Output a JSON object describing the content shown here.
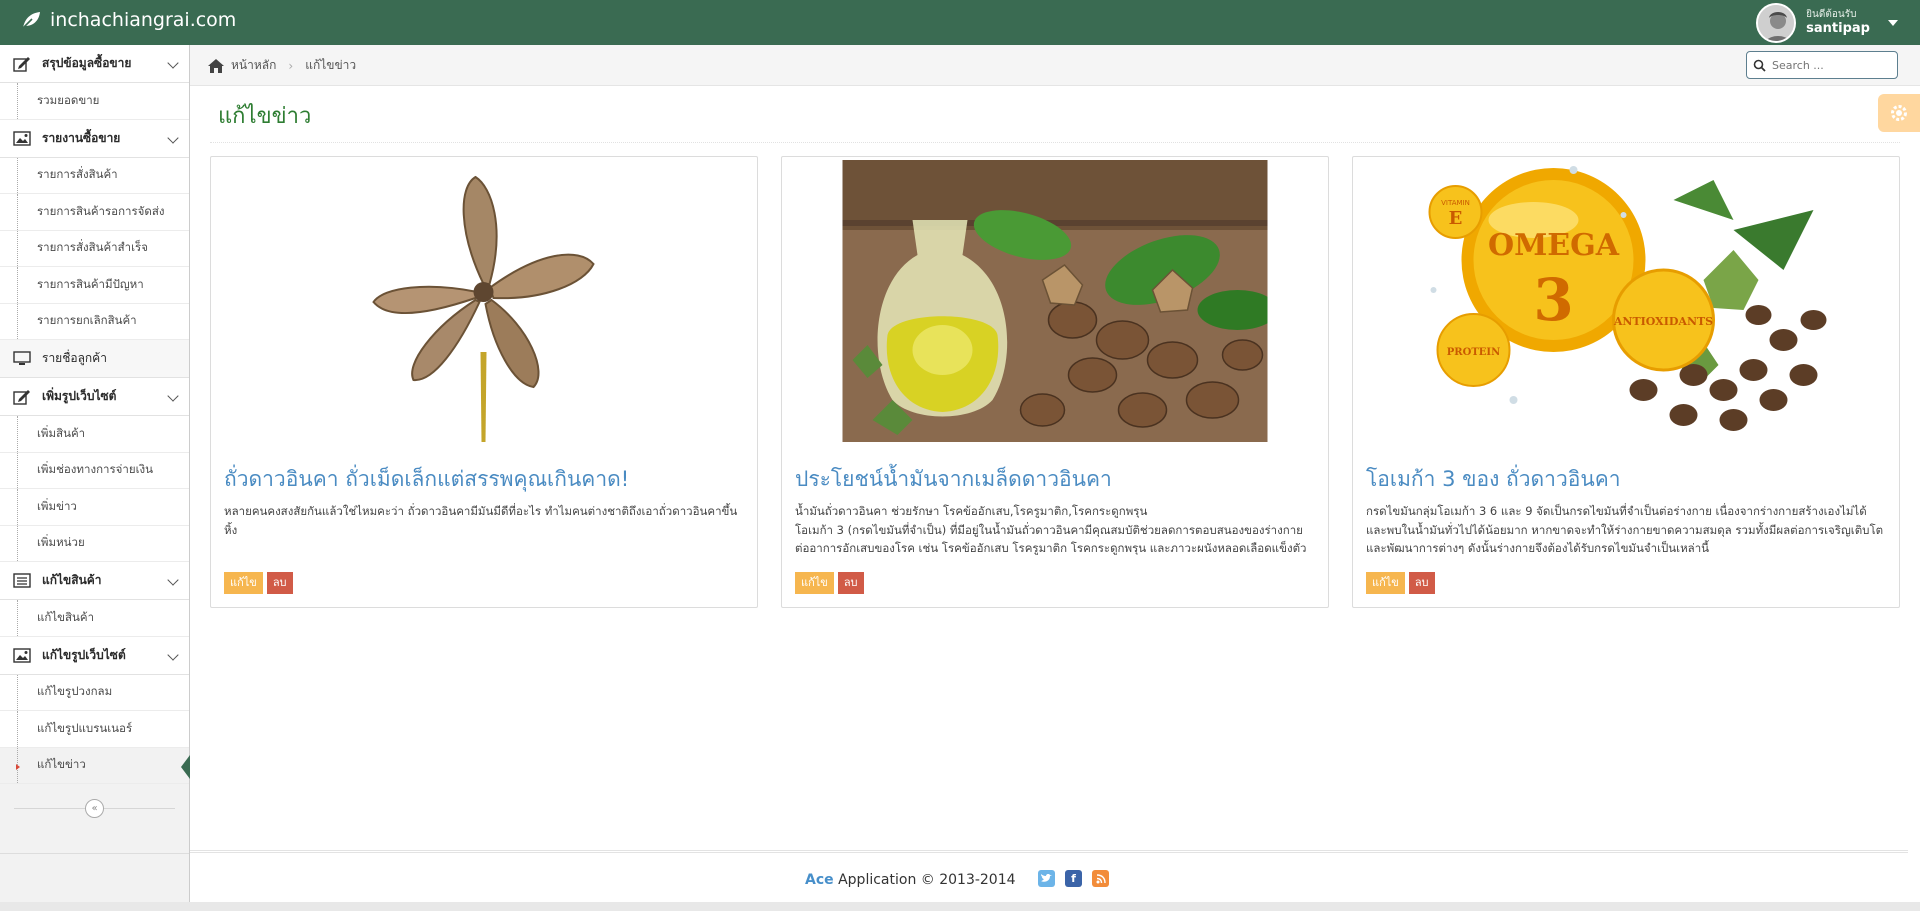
{
  "brand": {
    "name": "inchachiangrai.com",
    "icon": "leaf-icon"
  },
  "user": {
    "welcome": "ยินดีต้อนรับ",
    "name": "santipap"
  },
  "sidebar": {
    "groups": [
      {
        "title": "สรุปข้อมูลซื้อขาย",
        "icon": "pencil-square-icon",
        "items": [
          "รวมยอดขาย"
        ]
      },
      {
        "title": "รายงานซื้อขาย",
        "icon": "picture-icon",
        "items": [
          "รายการสั่งสินค้า",
          "รายการสินค้ารอการจัดส่ง",
          "รายการสั่งสินค้าสำเร็จ",
          "รายการสินค้ามีปัญหา",
          "รายการยกเลิกสินค้า"
        ]
      },
      {
        "title": "รายชื่อลูกค้า",
        "icon": "desktop-icon",
        "items": []
      },
      {
        "title": "เพิ่มรูปเว็บไซต์",
        "icon": "pencil-square-icon",
        "items": [
          "เพิ่มสินค้า",
          "เพิ่มช่องทางการจ่ายเงิน",
          "เพิ่มข่าว",
          "เพิ่มหน่วย"
        ]
      },
      {
        "title": "แก้ไขสินค้า",
        "icon": "list-icon",
        "items": [
          "แก้ไขสินค้า"
        ]
      },
      {
        "title": "แก้ไขรูปเว็บไซต์",
        "icon": "picture-icon",
        "items": [
          "แก้ไขรูปวงกลม",
          "แก้ไขรูปแบรนเนอร์",
          "แก้ไขข่าว"
        ]
      }
    ],
    "active_item": "แก้ไขข่าว"
  },
  "breadcrumb": {
    "home": "หน้าหลัก",
    "current": "แก้ไขข่าว"
  },
  "search": {
    "placeholder": "Search ..."
  },
  "page": {
    "title": "แก้ไขข่าว"
  },
  "cards": [
    {
      "title": "ถั่วดาวอินคา ถั่วเม็ดเล็กแต่สรรพคุณเกินคาด!",
      "description": "หลายคนคงสงสัยกันแล้วใช่ไหมคะว่า ถั่วดาวอินคามีมันมีดีที่อะไร ทำไมคนต่างชาติถึงเอาถั่วดาวอินคาขึ้นหิ้ง",
      "edit": "แก้ไข",
      "delete": "ลบ"
    },
    {
      "title": "ประโยชน์น้ำมันจากเมล็ดดาวอินคา",
      "description": "น้ำมันถั่วดาวอินคา ช่วยรักษา โรคข้ออักเสบ,โรครูมาติก,โรคกระดูกพรุน\nโอเมก้า 3 (กรดไขมันที่จำเป็น) ที่มีอยู่ในน้ำมันถั่วดาวอินคามีคุณสมบัติช่วยลดการตอบสนองของร่างกายต่ออาการอักเสบของโรค เช่น โรคข้ออักเสบ โรครูมาติก โรคกระดูกพรุน และภาวะผนังหลอดเลือดแข็งตัว",
      "edit": "แก้ไข",
      "delete": "ลบ"
    },
    {
      "title": "โอเมก้า 3 ของ ถั่วดาวอินคา",
      "description": "กรดไขมันกลุ่มโอเมก้า 3 6 และ 9 จัดเป็นกรดไขมันที่จำเป็นต่อร่างกาย เนื่องจากร่างกายสร้างเองไม่ได้ และพบในน้ำมันทั่วไปได้น้อยมาก หากขาดจะทำให้ร่างกายขาดความสมดุล รวมทั้งมีผลต่อการเจริญเติบโตและพัฒนาการต่างๆ ดังนั้นร่างกายจึงต้องได้รับกรดไขมันจำเป็นเหล่านี้",
      "edit": "แก้ไข",
      "delete": "ลบ"
    }
  ],
  "omega_image": {
    "vitamin": "VITAMIN",
    "e": "E",
    "omega": "OMEGA",
    "three": "3",
    "antioxidants": "ANTIOXIDANTS",
    "protein": "PROTEIN"
  },
  "footer": {
    "brand": "Ace",
    "text": "Application © 2013-2014",
    "icons": [
      "twitter-icon",
      "facebook-icon",
      "rss-icon"
    ]
  },
  "colors": {
    "navbar": "#3a6b52",
    "title": "#2e7d32",
    "link": "#4a8bc2",
    "edit": "#f6b64f",
    "delete": "#d15b47"
  }
}
